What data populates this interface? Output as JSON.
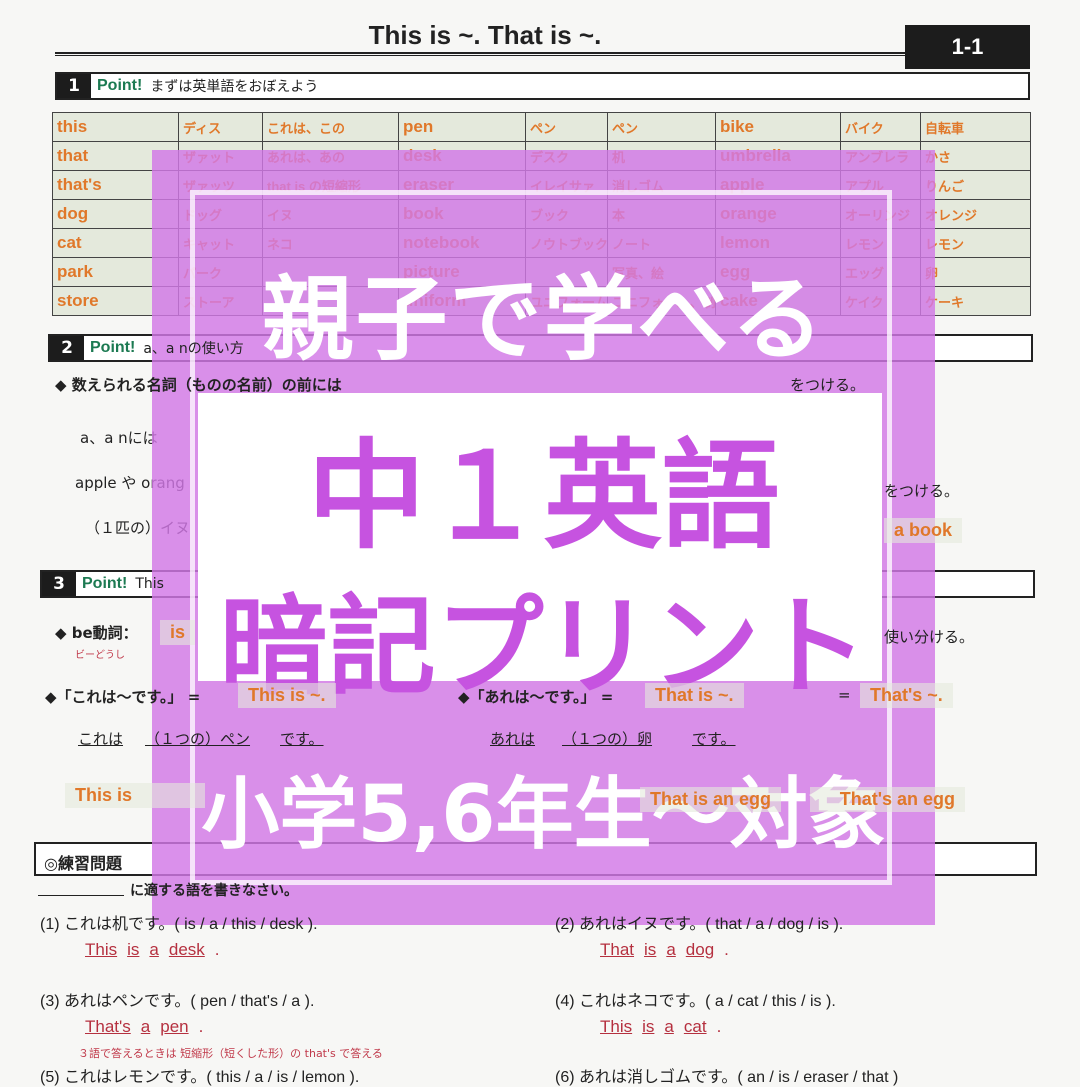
{
  "header": {
    "title": "This is ~.  That is ~.",
    "unit": "1-1"
  },
  "sections": [
    {
      "num": "1",
      "point": "Point!",
      "text": "まずは英単語をおぼえよう"
    },
    {
      "num": "2",
      "point": "Point!",
      "text": "a、a nの使い方"
    },
    {
      "num": "3",
      "point": "Point!",
      "text": "This"
    }
  ],
  "vocab": [
    [
      [
        "this",
        "ディス",
        "これは、この"
      ],
      [
        "that",
        "ザァット",
        "あれは、あの"
      ],
      [
        "that's",
        "ザァッツ",
        "that is の短縮形"
      ],
      [
        "dog",
        "ドッグ",
        "イヌ"
      ],
      [
        "cat",
        "キャット",
        "ネコ"
      ],
      [
        "park",
        "パーク",
        ""
      ],
      [
        "store",
        "ストーア",
        ""
      ]
    ],
    [
      [
        "pen",
        "ペン",
        "ペン"
      ],
      [
        "desk",
        "デスク",
        "机"
      ],
      [
        "eraser",
        "イレイサァ",
        "消しゴム"
      ],
      [
        "book",
        "ブック",
        "本"
      ],
      [
        "notebook",
        "ノウトブック",
        "ノート"
      ],
      [
        "picture",
        "",
        "写真、絵"
      ],
      [
        "uniform",
        "ユニフォーム",
        "ユニフォーム、制服"
      ]
    ],
    [
      [
        "bike",
        "バイク",
        "自転車"
      ],
      [
        "umbrella",
        "アンブレラ",
        "かさ"
      ],
      [
        "apple",
        "アプル",
        "りんご"
      ],
      [
        "orange",
        "オーリンジ",
        "オレンジ"
      ],
      [
        "lemon",
        "レモン",
        "レモン"
      ],
      [
        "egg",
        "エッグ",
        "卵"
      ],
      [
        "cake",
        "ケイク",
        "ケーキ"
      ]
    ]
  ],
  "sec2": {
    "l1": "◆ 数えられる名詞（ものの名前）の前には",
    "l1b": "をつける。",
    "l2": "a、a nには",
    "l3": "apple や orang",
    "l3b": "をつける。",
    "l4": "（１匹の）イヌ",
    "l4b": "a book"
  },
  "sec3": {
    "be": "◆ be動詞：",
    "be_val": "is",
    "be_read": "ビーどうし",
    "be_tail": "使い分ける。",
    "this_jp": "◆「これは〜です。」 =",
    "this_en": "This   is   ~.",
    "that_jp": "◆「あれは〜です。」 =",
    "that_en": "That   is   ~.",
    "eq": "=",
    "thats": "That's  ~.",
    "ex1": [
      "これは",
      "（１つの）ペン",
      "です。"
    ],
    "ex2": [
      "あれは",
      "（１つの）卵",
      "です。"
    ],
    "ans1": "This   is",
    "ans2": "That   is   an egg",
    "ans3": "That's   an egg"
  },
  "practice": {
    "title": "◎練習問題",
    "instr": "に適する語を書きなさい。",
    "items": [
      {
        "q": "(1)  これは机です。( is / a / this / desk ).",
        "a": [
          "This",
          "is",
          "a",
          "desk"
        ]
      },
      {
        "q": "(2)  あれはイヌです。( that / a / dog / is ).",
        "a": [
          "That",
          "is",
          "a",
          "dog"
        ]
      },
      {
        "q": "(3)  あれはペンです。( pen / that's / a ).",
        "a": [
          "That's",
          "a",
          "pen"
        ],
        "note": "３語で答えるときは 短縮形（短くした形）の that's で答える"
      },
      {
        "q": "(4)  これはネコです。( a / cat / this / is ).",
        "a": [
          "This",
          "is",
          "a",
          "cat"
        ]
      },
      {
        "q": "(5)  これはレモンです。( this / a / is / lemon ).",
        "a": []
      },
      {
        "q": "(6)  あれは消しゴムです。( an / is / eraser / that )",
        "a": []
      }
    ]
  },
  "overlay": {
    "line1": "親子で学べる",
    "line2": "中１英語",
    "line3": "暗記プリント",
    "line4": "小学5,6年生〜対象",
    "color": "#c653e0"
  }
}
